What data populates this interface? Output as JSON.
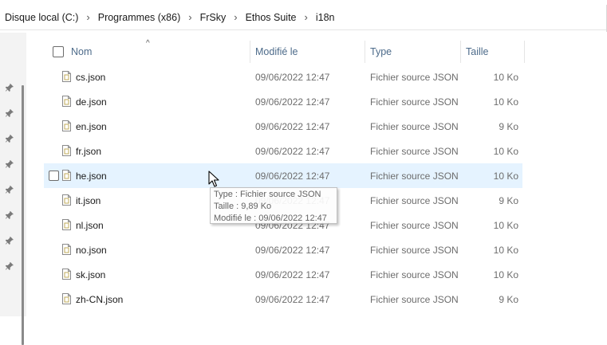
{
  "breadcrumb": [
    "Disque local (C:)",
    "Programmes (x86)",
    "FrSky",
    "Ethos Suite",
    "i18n"
  ],
  "breadcrumb_separator": "›",
  "columns": {
    "name": "Nom",
    "modified": "Modifié le",
    "type": "Type",
    "size": "Taille"
  },
  "sort_indicator": "^",
  "files": [
    {
      "name": "cs.json",
      "modified": "09/06/2022 12:47",
      "type": "Fichier source JSON",
      "size": "10 Ko"
    },
    {
      "name": "de.json",
      "modified": "09/06/2022 12:47",
      "type": "Fichier source JSON",
      "size": "10 Ko"
    },
    {
      "name": "en.json",
      "modified": "09/06/2022 12:47",
      "type": "Fichier source JSON",
      "size": "9 Ko"
    },
    {
      "name": "fr.json",
      "modified": "09/06/2022 12:47",
      "type": "Fichier source JSON",
      "size": "10 Ko"
    },
    {
      "name": "he.json",
      "modified": "09/06/2022 12:47",
      "type": "Fichier source JSON",
      "size": "10 Ko",
      "hovered": true
    },
    {
      "name": "it.json",
      "modified": "09/06/2022 12:47",
      "type": "Fichier source JSON",
      "size": "9 Ko"
    },
    {
      "name": "nl.json",
      "modified": "09/06/2022 12:47",
      "type": "Fichier source JSON",
      "size": "10 Ko"
    },
    {
      "name": "no.json",
      "modified": "09/06/2022 12:47",
      "type": "Fichier source JSON",
      "size": "10 Ko"
    },
    {
      "name": "sk.json",
      "modified": "09/06/2022 12:47",
      "type": "Fichier source JSON",
      "size": "10 Ko"
    },
    {
      "name": "zh-CN.json",
      "modified": "09/06/2022 12:47",
      "type": "Fichier source JSON",
      "size": "9 Ko"
    }
  ],
  "tooltip": {
    "line1": "Type : Fichier source JSON",
    "line2": "Taille : 9,89 Ko",
    "line3": "Modifié le : 09/06/2022 12:47"
  },
  "colors": {
    "hover_row": "#e5f3ff",
    "header_text": "#4d6b8a",
    "muted_text": "#6d6d6d"
  },
  "icons": {
    "file": "json-file-icon",
    "pin": "pin-icon",
    "cursor": "mouse-cursor-icon"
  }
}
